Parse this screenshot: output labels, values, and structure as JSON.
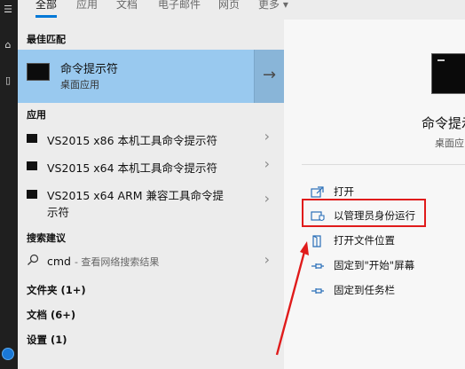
{
  "tabs": [
    "全部",
    "应用",
    "文档",
    "电子邮件",
    "网页",
    "更多 ▾"
  ],
  "best_match": {
    "section": "最佳匹配",
    "name": "命令提示符",
    "sub": "桌面应用",
    "arrow": "→"
  },
  "apps": {
    "section": "应用",
    "items": [
      "VS2015 x86 本机工具命令提示符",
      "VS2015 x64 本机工具命令提示符",
      "VS2015 x64 ARM 兼容工具命令提",
      "示符"
    ]
  },
  "suggestions": {
    "section": "搜索建议",
    "query": "cmd",
    "hint": "- 查看网络搜索结果"
  },
  "groups": [
    "文件夹 (1+)",
    "文档 (6+)",
    "设置 (1)"
  ],
  "detail": {
    "title": "命令提示",
    "sub": "桌面应",
    "actions": [
      "打开",
      "以管理员身份运行",
      "打开文件位置",
      "固定到\"开始\"屏幕",
      "固定到任务栏"
    ]
  },
  "colors": {
    "accent": "#0078d7",
    "selected_bg": "#99c9ef",
    "annotation": "#e01b1b"
  }
}
